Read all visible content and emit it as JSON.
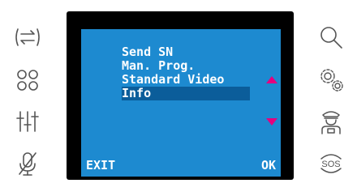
{
  "left_icons": [
    {
      "name": "transfer-arrows-icon"
    },
    {
      "name": "four-circles-icon"
    },
    {
      "name": "sliders-icon"
    },
    {
      "name": "mute-microphone-icon"
    }
  ],
  "right_icons": [
    {
      "name": "search-icon"
    },
    {
      "name": "gears-icon"
    },
    {
      "name": "concierge-icon"
    },
    {
      "name": "sos-icon",
      "label": "SOS"
    }
  ],
  "screen": {
    "menu": [
      {
        "label": "Send SN",
        "selected": false
      },
      {
        "label": "Man. Prog.",
        "selected": false
      },
      {
        "label": "Standard Video",
        "selected": false
      },
      {
        "label": "Info",
        "selected": true
      }
    ],
    "softkey_left": "EXIT",
    "softkey_right": "OK",
    "arrow_color": "#e6007e",
    "background_color": "#1d8ad0",
    "selection_color": "#0b5d9a"
  }
}
